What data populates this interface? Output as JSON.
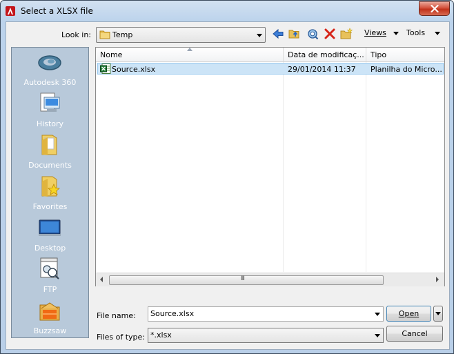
{
  "window": {
    "title": "Select a XLSX file",
    "app_icon": "autocad-logo-icon",
    "close_icon": "close-icon"
  },
  "toolbar": {
    "look_in_label": "Look in:",
    "look_in_value": "Temp",
    "icons": [
      "back-arrow-icon",
      "up-folder-icon",
      "search-web-icon",
      "delete-icon",
      "new-folder-icon"
    ],
    "views_label": "Views",
    "tools_label": "Tools"
  },
  "places": [
    {
      "label": "Autodesk 360",
      "icon": "autodesk-360-icon"
    },
    {
      "label": "History",
      "icon": "history-icon"
    },
    {
      "label": "Documents",
      "icon": "documents-folder-icon"
    },
    {
      "label": "Favorites",
      "icon": "favorites-folder-icon"
    },
    {
      "label": "Desktop",
      "icon": "desktop-icon"
    },
    {
      "label": "FTP",
      "icon": "ftp-icon"
    },
    {
      "label": "Buzzsaw",
      "icon": "buzzsaw-icon"
    }
  ],
  "file_list": {
    "columns": [
      "Nome",
      "Data de modificaç...",
      "Tipo"
    ],
    "rows": [
      {
        "name": "Source.xlsx",
        "date": "29/01/2014 11:37",
        "type": "Planilha do Micro...",
        "icon": "excel-file-icon"
      }
    ],
    "scroll_grip": "III"
  },
  "bottom": {
    "file_name_label": "File name:",
    "file_name_value": "Source.xlsx",
    "files_of_type_label": "Files of type:",
    "files_of_type_value": "*.xlsx",
    "open_label": "Open",
    "cancel_label": "Cancel"
  },
  "colors": {
    "selection": "#cce4f7",
    "places_panel": "#b8c9da",
    "close_button": "#c1321b"
  }
}
